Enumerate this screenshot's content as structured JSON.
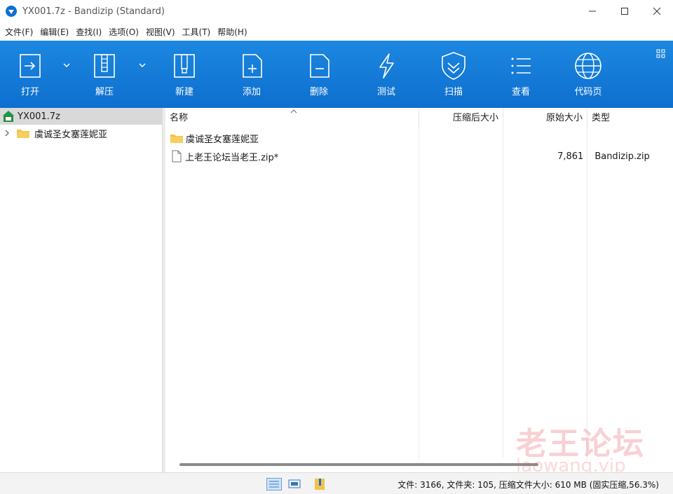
{
  "window": {
    "title": "YX001.7z - Bandizip (Standard)"
  },
  "menu": [
    "文件(F)",
    "编辑(E)",
    "查找(I)",
    "选项(O)",
    "视图(V)",
    "工具(T)",
    "帮助(H)"
  ],
  "toolbar": {
    "open": "打开",
    "extract": "解压",
    "new": "新建",
    "add": "添加",
    "delete": "删除",
    "test": "测试",
    "scan": "扫描",
    "view": "查看",
    "codepage": "代码页"
  },
  "tree": {
    "root": "YX001.7z",
    "child": "虞诚圣女塞莲妮亚"
  },
  "list": {
    "headers": {
      "name": "名称",
      "packed": "压缩后大小",
      "size": "原始大小",
      "type": "类型"
    },
    "rows": [
      {
        "name": "虞诚圣女塞莲妮亚",
        "packed": "",
        "size": "",
        "type": ""
      },
      {
        "name": "上老王论坛当老王.zip*",
        "packed": "",
        "size": "7,861",
        "type": "Bandizip.zip"
      }
    ]
  },
  "status": {
    "text": "文件: 3166, 文件夹: 105, 压缩文件大小: 610 MB (固实压缩,56.3%)"
  },
  "watermark": {
    "cn": "老王论坛",
    "en": "laowang.vip"
  },
  "colors": {
    "toolbar": "#1c87e0",
    "folder": "#f2c34b"
  }
}
